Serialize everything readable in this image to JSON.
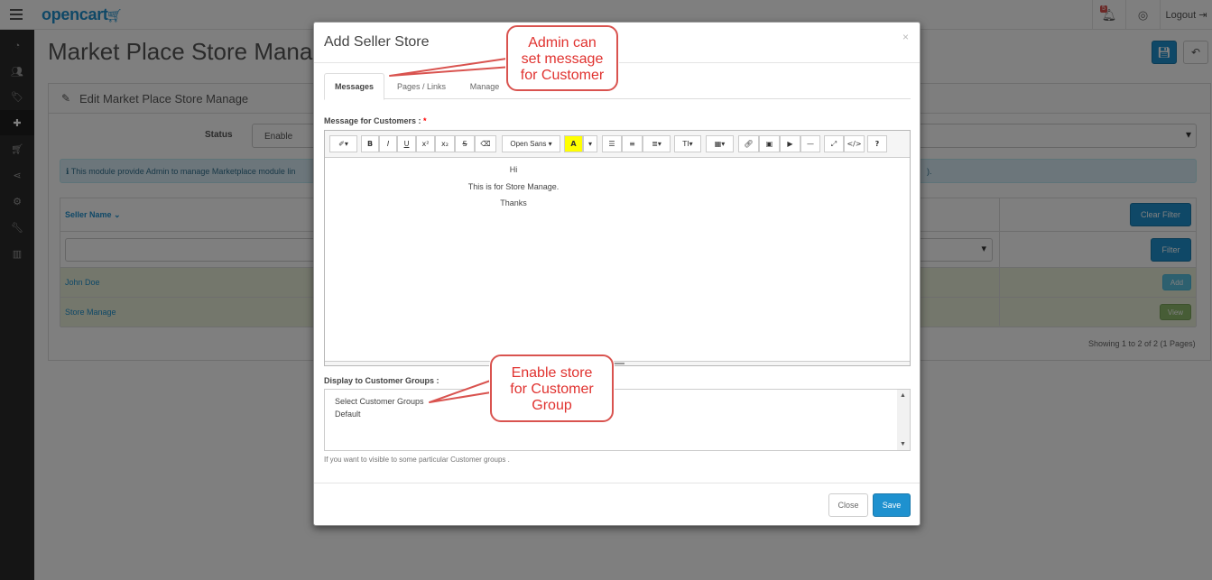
{
  "app": {
    "logo": "opencart"
  },
  "topbar": {
    "notification_count": "5",
    "logout_label": "Logout"
  },
  "page": {
    "title": "Market Place Store Manage",
    "panel_title": "Edit Market Place Store Manage",
    "status_label": "Status",
    "status_value": "Enable",
    "info_text": "This module provide Admin to manage Marketplace module lin",
    "info_tail": ").",
    "table": {
      "seller_header": "Seller Name",
      "clear_filter": "Clear Filter",
      "filter": "Filter",
      "rows": [
        {
          "name": "John Doe",
          "action": "Add"
        },
        {
          "name": "Store Manage",
          "action": "View"
        }
      ]
    },
    "pagination": "Showing 1 to 2 of 2 (1 Pages)"
  },
  "modal": {
    "title": "Add Seller Store",
    "close_symbol": "×",
    "tabs": [
      "Messages",
      "Pages / Links",
      "Manage"
    ],
    "message_label": "Message for Customers :",
    "required_mark": "*",
    "toolbar": {
      "font_name": "Open Sans",
      "buttons": [
        "bold",
        "italic",
        "underline",
        "superscript",
        "subscript",
        "strikethrough",
        "eraser",
        "highlight",
        "unordered-list",
        "ordered-list",
        "align",
        "text-size",
        "table",
        "link",
        "picture",
        "video",
        "horizontal-rule",
        "fullscreen",
        "code",
        "help"
      ]
    },
    "editor_lines": [
      "Hi",
      "This is for Store Manage.",
      "Thanks"
    ],
    "groups_label": "Display to Customer Groups :",
    "group_options": [
      "Select Customer Groups",
      "Default"
    ],
    "groups_help": "If you want to visible to some particular Customer groups .",
    "close_label": "Close",
    "save_label": "Save"
  },
  "callouts": {
    "message": "Admin can\nset  message\nfor Customer",
    "groups": "Enable store\nfor Customer\nGroup"
  },
  "colors": {
    "primary": "#1e91cf",
    "callout": "#d9534f",
    "sidebar": "#2b2b2b",
    "row_highlight": "#e8efd8"
  }
}
